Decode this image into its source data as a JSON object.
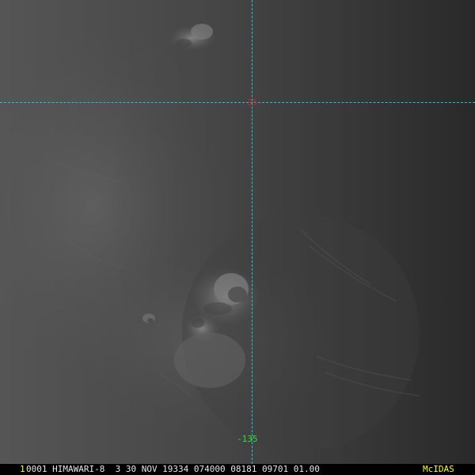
{
  "overlay": {
    "latitude_label": "35",
    "longitude_label": "-135"
  },
  "status_bar": {
    "frame_number": "1",
    "info": "0001 HIMAWARI-8  3 30 NOV 19334 074000 08181 09701 01.00",
    "brand": "McIDAS"
  },
  "colors": {
    "grid_line": "#19c8d8",
    "latitude_label": "#d22222",
    "longitude_label": "#33dd33",
    "frame_number": "#ffff00",
    "status_text": "#e8e8e8",
    "brand": "#ffff00"
  }
}
